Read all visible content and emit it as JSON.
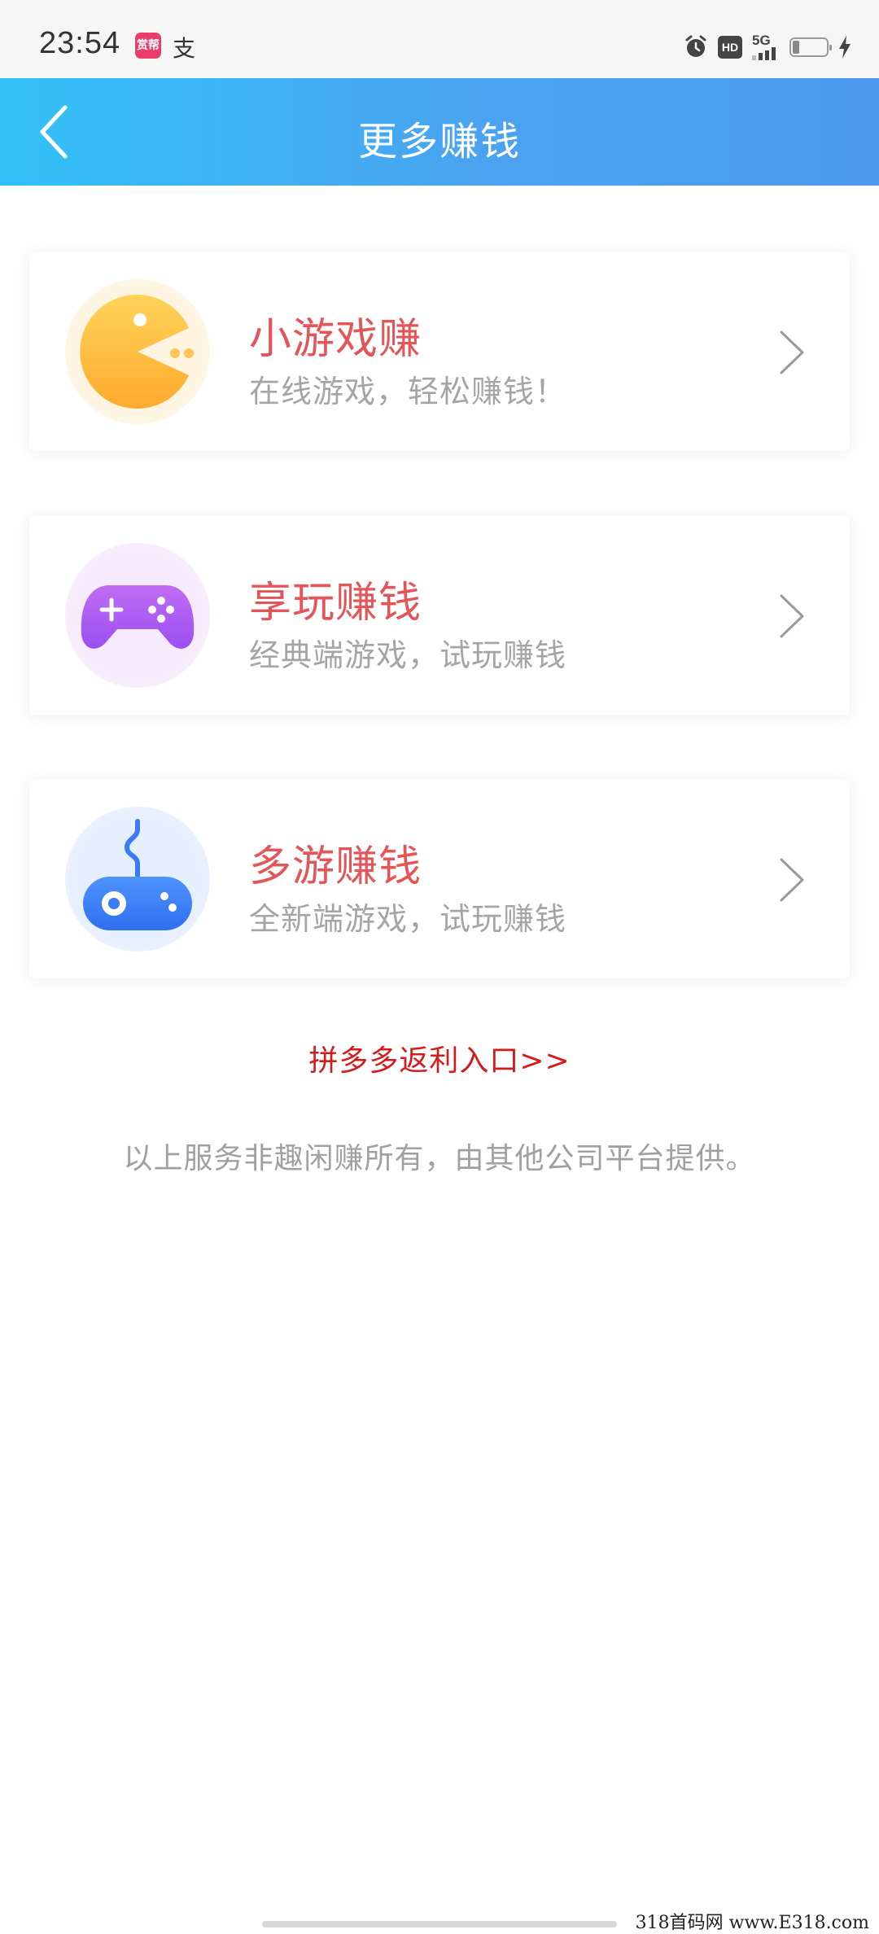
{
  "status_bar": {
    "time": "23:54",
    "app_icon_1_text": "赏帮",
    "app_icon_2_text": "支",
    "hd_label": "HD",
    "network_label": "5G"
  },
  "header": {
    "title": "更多赚钱"
  },
  "cards": [
    {
      "title": "小游戏赚",
      "subtitle": "在线游戏，轻松赚钱！",
      "icon": "pacman-icon",
      "color": "#ffb93a"
    },
    {
      "title": "享玩赚钱",
      "subtitle": "经典端游戏，试玩赚钱",
      "icon": "gamepad-icon",
      "color": "#a855f0"
    },
    {
      "title": "多游赚钱",
      "subtitle": "全新端游戏，试玩赚钱",
      "icon": "joystick-icon",
      "color": "#3b82f6"
    }
  ],
  "pdd_link": "拼多多返利入口>>",
  "disclaimer": "以上服务非趣闲赚所有，由其他公司平台提供。",
  "watermark": "318首码网 www.E318.com",
  "colors": {
    "header_start": "#32c1f7",
    "header_end": "#4d9af0",
    "card_title": "#e4555a",
    "link": "#d31b1b"
  }
}
